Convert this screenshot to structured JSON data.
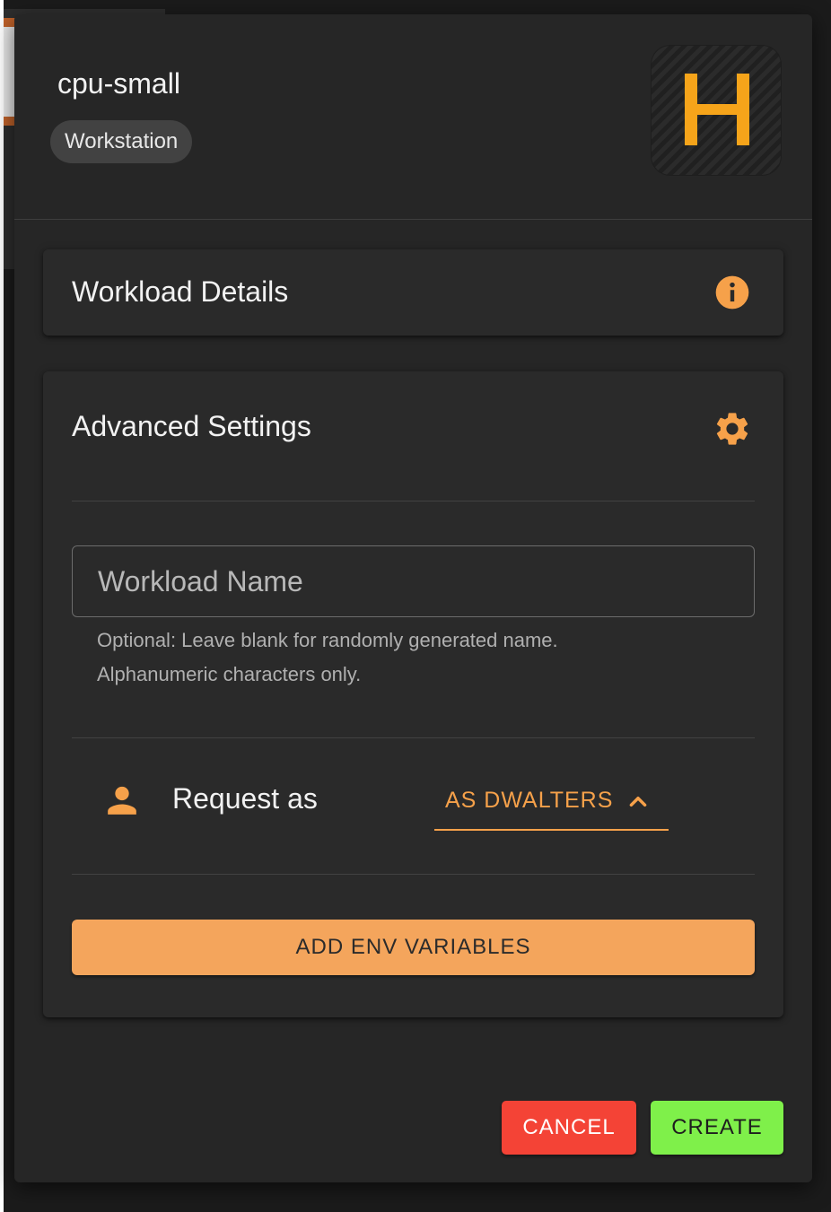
{
  "colors": {
    "accent_orange": "#f6a14a",
    "logo_yellow": "#f6a41a",
    "cancel_red": "#f44336",
    "create_green": "#7ff04a",
    "dialog_bg": "#262626"
  },
  "header": {
    "title": "cpu-small",
    "chip_label": "Workstation",
    "logo_icon": "h-logo-icon"
  },
  "workload_details": {
    "title": "Workload Details",
    "icon": "info-icon"
  },
  "advanced_settings": {
    "title": "Advanced Settings",
    "icon": "gear-icon",
    "workload_name": {
      "value": "",
      "placeholder": "Workload Name",
      "helper_lines": [
        "Optional: Leave blank for randomly generated name.",
        "Alphanumeric characters only."
      ]
    },
    "request_as": {
      "icon": "person-icon",
      "label": "Request as",
      "selected": "AS DWALTERS",
      "chevron_icon": "chevron-up-icon"
    },
    "env_button_label": "ADD ENV VARIABLES"
  },
  "actions": {
    "cancel_label": "CANCEL",
    "create_label": "CREATE"
  }
}
